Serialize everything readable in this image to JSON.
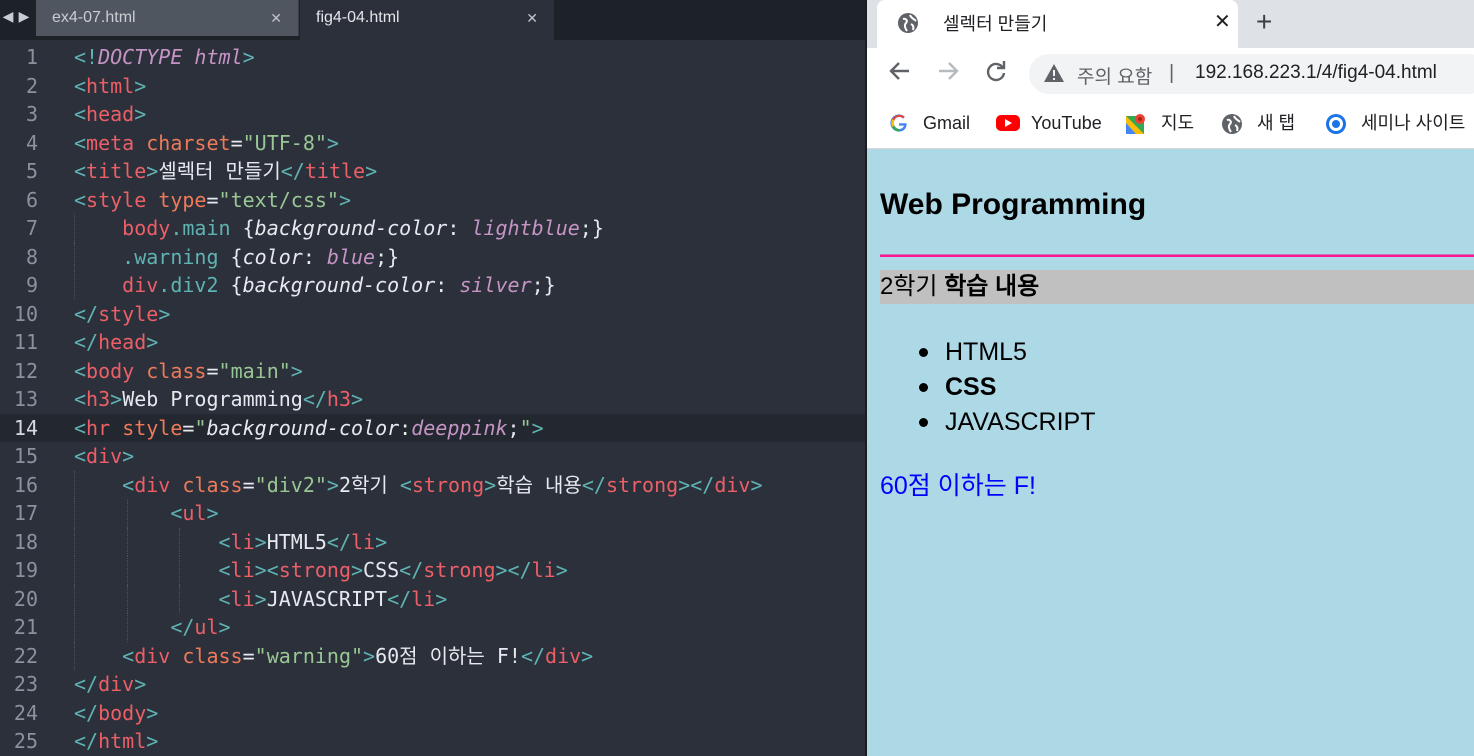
{
  "editor": {
    "tabs": [
      {
        "label": "ex4-07.html",
        "active": false
      },
      {
        "label": "fig4-04.html",
        "active": true
      }
    ],
    "active_line": 14,
    "lines": [
      [
        [
          "p",
          "<!"
        ],
        [
          "dt",
          "DOCTYPE html"
        ],
        [
          "p",
          ">"
        ]
      ],
      [
        [
          "p",
          "<"
        ],
        [
          "t",
          "html"
        ],
        [
          "p",
          ">"
        ]
      ],
      [
        [
          "p",
          "<"
        ],
        [
          "t",
          "head"
        ],
        [
          "p",
          ">"
        ]
      ],
      [
        [
          "p",
          "<"
        ],
        [
          "t",
          "meta"
        ],
        [
          "x",
          " "
        ],
        [
          "a",
          "charset"
        ],
        [
          "x",
          "="
        ],
        [
          "s",
          "\"UTF-8\""
        ],
        [
          "p",
          ">"
        ]
      ],
      [
        [
          "p",
          "<"
        ],
        [
          "t",
          "title"
        ],
        [
          "p",
          ">"
        ],
        [
          "x",
          "셀렉터 만들기"
        ],
        [
          "p",
          "</"
        ],
        [
          "t",
          "title"
        ],
        [
          "p",
          ">"
        ]
      ],
      [
        [
          "p",
          "<"
        ],
        [
          "t",
          "style"
        ],
        [
          "x",
          " "
        ],
        [
          "a",
          "type"
        ],
        [
          "x",
          "="
        ],
        [
          "s",
          "\"text/css\""
        ],
        [
          "p",
          ">"
        ]
      ],
      [
        [
          "x",
          "    "
        ],
        [
          "sel",
          "body"
        ],
        [
          "cls",
          ".main"
        ],
        [
          "x",
          " {"
        ],
        [
          "it",
          "background-color"
        ],
        [
          "x",
          ": "
        ],
        [
          "v",
          "lightblue"
        ],
        [
          "x",
          ";}"
        ]
      ],
      [
        [
          "x",
          "    "
        ],
        [
          "cls",
          ".warning"
        ],
        [
          "x",
          " {"
        ],
        [
          "it",
          "color"
        ],
        [
          "x",
          ": "
        ],
        [
          "v",
          "blue"
        ],
        [
          "x",
          ";}"
        ]
      ],
      [
        [
          "x",
          "    "
        ],
        [
          "sel",
          "div"
        ],
        [
          "cls",
          ".div2"
        ],
        [
          "x",
          " {"
        ],
        [
          "it",
          "background-color"
        ],
        [
          "x",
          ": "
        ],
        [
          "v",
          "silver"
        ],
        [
          "x",
          ";}"
        ]
      ],
      [
        [
          "p",
          "</"
        ],
        [
          "t",
          "style"
        ],
        [
          "p",
          ">"
        ]
      ],
      [
        [
          "p",
          "</"
        ],
        [
          "t",
          "head"
        ],
        [
          "p",
          ">"
        ]
      ],
      [
        [
          "p",
          "<"
        ],
        [
          "t",
          "body"
        ],
        [
          "x",
          " "
        ],
        [
          "a",
          "class"
        ],
        [
          "x",
          "="
        ],
        [
          "s",
          "\"main\""
        ],
        [
          "p",
          ">"
        ]
      ],
      [
        [
          "p",
          "<"
        ],
        [
          "t",
          "h3"
        ],
        [
          "p",
          ">"
        ],
        [
          "x",
          "Web Programming"
        ],
        [
          "p",
          "</"
        ],
        [
          "t",
          "h3"
        ],
        [
          "p",
          ">"
        ]
      ],
      [
        [
          "p",
          "<"
        ],
        [
          "t",
          "hr"
        ],
        [
          "x",
          " "
        ],
        [
          "a",
          "style"
        ],
        [
          "x",
          "="
        ],
        [
          "s",
          "\""
        ],
        [
          "it",
          "background-color"
        ],
        [
          "x",
          ":"
        ],
        [
          "v",
          "deeppink"
        ],
        [
          "x",
          ";"
        ],
        [
          "s",
          "\""
        ],
        [
          "p",
          ">"
        ]
      ],
      [
        [
          "p",
          "<"
        ],
        [
          "t",
          "div"
        ],
        [
          "p",
          ">"
        ]
      ],
      [
        [
          "x",
          "    "
        ],
        [
          "p",
          "<"
        ],
        [
          "t",
          "div"
        ],
        [
          "x",
          " "
        ],
        [
          "a",
          "class"
        ],
        [
          "x",
          "="
        ],
        [
          "s",
          "\"div2\""
        ],
        [
          "p",
          ">"
        ],
        [
          "x",
          "2학기 "
        ],
        [
          "p",
          "<"
        ],
        [
          "t",
          "strong"
        ],
        [
          "p",
          ">"
        ],
        [
          "x",
          "학습 내용"
        ],
        [
          "p",
          "</"
        ],
        [
          "t",
          "strong"
        ],
        [
          "p",
          "></"
        ],
        [
          "t",
          "div"
        ],
        [
          "p",
          ">"
        ]
      ],
      [
        [
          "x",
          "        "
        ],
        [
          "p",
          "<"
        ],
        [
          "t",
          "ul"
        ],
        [
          "p",
          ">"
        ]
      ],
      [
        [
          "x",
          "            "
        ],
        [
          "p",
          "<"
        ],
        [
          "t",
          "li"
        ],
        [
          "p",
          ">"
        ],
        [
          "x",
          "HTML5"
        ],
        [
          "p",
          "</"
        ],
        [
          "t",
          "li"
        ],
        [
          "p",
          ">"
        ]
      ],
      [
        [
          "x",
          "            "
        ],
        [
          "p",
          "<"
        ],
        [
          "t",
          "li"
        ],
        [
          "p",
          "><"
        ],
        [
          "t",
          "strong"
        ],
        [
          "p",
          ">"
        ],
        [
          "x",
          "CSS"
        ],
        [
          "p",
          "</"
        ],
        [
          "t",
          "strong"
        ],
        [
          "p",
          "></"
        ],
        [
          "t",
          "li"
        ],
        [
          "p",
          ">"
        ]
      ],
      [
        [
          "x",
          "            "
        ],
        [
          "p",
          "<"
        ],
        [
          "t",
          "li"
        ],
        [
          "p",
          ">"
        ],
        [
          "x",
          "JAVASCRIPT"
        ],
        [
          "p",
          "</"
        ],
        [
          "t",
          "li"
        ],
        [
          "p",
          ">"
        ]
      ],
      [
        [
          "x",
          "        "
        ],
        [
          "p",
          "</"
        ],
        [
          "t",
          "ul"
        ],
        [
          "p",
          ">"
        ]
      ],
      [
        [
          "x",
          "    "
        ],
        [
          "p",
          "<"
        ],
        [
          "t",
          "div"
        ],
        [
          "x",
          " "
        ],
        [
          "a",
          "class"
        ],
        [
          "x",
          "="
        ],
        [
          "s",
          "\"warning\""
        ],
        [
          "p",
          ">"
        ],
        [
          "x",
          "60점 이하는 F!"
        ],
        [
          "p",
          "</"
        ],
        [
          "t",
          "div"
        ],
        [
          "p",
          ">"
        ]
      ],
      [
        [
          "p",
          "</"
        ],
        [
          "t",
          "div"
        ],
        [
          "p",
          ">"
        ]
      ],
      [
        [
          "p",
          "</"
        ],
        [
          "t",
          "body"
        ],
        [
          "p",
          ">"
        ]
      ],
      [
        [
          "p",
          "</"
        ],
        [
          "t",
          "html"
        ],
        [
          "p",
          ">"
        ]
      ]
    ]
  },
  "browser": {
    "tab_title": "셀렉터 만들기",
    "tab_close": "✕",
    "new_tab": "+",
    "security_text": "주의 요함",
    "separator": "|",
    "url": "192.168.223.1/4/fig4-04.html",
    "bookmarks": [
      {
        "label": "Gmail",
        "icon": "google-icon"
      },
      {
        "label": "YouTube",
        "icon": "youtube-icon"
      },
      {
        "label": "지도",
        "icon": "maps-icon"
      },
      {
        "label": "새 탭",
        "icon": "globe-icon"
      },
      {
        "label": "세미나 사이트",
        "icon": "chrome-icon"
      }
    ],
    "page": {
      "heading": "Web Programming",
      "div2_text": "2학기 ",
      "div2_strong": "학습 내용",
      "list": [
        {
          "text": "HTML5",
          "bold": false
        },
        {
          "text": "CSS",
          "bold": true
        },
        {
          "text": "JAVASCRIPT",
          "bold": false
        }
      ],
      "warning": "60점 이하는 F!"
    },
    "colors": {
      "page_bg": "#add8e6",
      "hr": "#ff1493",
      "div2_bg": "#c0c0c0",
      "warning": "#0000ff"
    }
  }
}
